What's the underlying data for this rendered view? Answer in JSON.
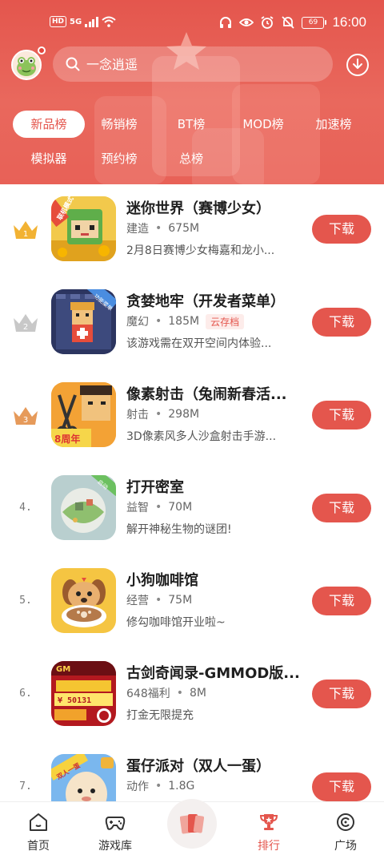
{
  "status_bar": {
    "time": "16:00",
    "battery": "69",
    "hd": "HD",
    "network": "5G"
  },
  "search": {
    "placeholder": "一念逍遥"
  },
  "tabs": [
    {
      "label": "新品榜",
      "active": true
    },
    {
      "label": "畅销榜",
      "active": false
    },
    {
      "label": "BT榜",
      "active": false
    },
    {
      "label": "MOD榜",
      "active": false
    },
    {
      "label": "加速榜",
      "active": false
    },
    {
      "label": "模拟器",
      "active": false
    },
    {
      "label": "预约榜",
      "active": false
    },
    {
      "label": "总榜",
      "active": false
    }
  ],
  "games": [
    {
      "rank": "1",
      "title": "迷你世界（赛博少女）",
      "category": "建造",
      "size": "675M",
      "tag": "",
      "desc": "2月8日赛博少女梅嘉和龙小...",
      "button": "下载",
      "icon_label": "联机模式"
    },
    {
      "rank": "2",
      "title": "贪婪地牢（开发者菜单）",
      "category": "魔幻",
      "size": "185M",
      "tag": "云存档",
      "desc": "该游戏需在双开空间内体验...",
      "button": "下载",
      "icon_label": "功能菜单"
    },
    {
      "rank": "3",
      "title": "像素射击（兔闹新春活...",
      "category": "射击",
      "size": "298M",
      "tag": "",
      "desc": "3D像素风多人沙盒射击手游...",
      "button": "下载",
      "icon_label": "8周年"
    },
    {
      "rank": "4.",
      "title": "打开密室",
      "category": "益智",
      "size": "70M",
      "tag": "",
      "desc": "解开神秘生物的谜团!",
      "button": "下载",
      "icon_label": "启动"
    },
    {
      "rank": "5.",
      "title": "小狗咖啡馆",
      "category": "经营",
      "size": "75M",
      "tag": "",
      "desc": "修勾咖啡馆开业啦~",
      "button": "下载",
      "icon_label": ""
    },
    {
      "rank": "6.",
      "title": "古剑奇闻录-GMMOD版...",
      "category": "648福利",
      "size": "8M",
      "tag": "",
      "desc": "打金无限提充",
      "button": "下载",
      "icon_label": "¥ 50131"
    },
    {
      "rank": "7.",
      "title": "蛋仔派对（双人一蛋）",
      "category": "动作",
      "size": "1.8G",
      "tag": "",
      "desc": "",
      "button": "下载",
      "icon_label": "双人一蛋"
    }
  ],
  "bottom_nav": [
    {
      "label": "首页",
      "icon": "home-icon"
    },
    {
      "label": "游戏库",
      "icon": "gamepad-icon"
    },
    {
      "label": "",
      "icon": "cards-icon"
    },
    {
      "label": "排行",
      "icon": "trophy-icon",
      "active": true
    },
    {
      "label": "广场",
      "icon": "plaza-icon"
    }
  ],
  "colors": {
    "accent": "#e4564d",
    "gold": "#f2b233",
    "silver": "#c8c8c8",
    "bronze": "#e69a5a"
  }
}
